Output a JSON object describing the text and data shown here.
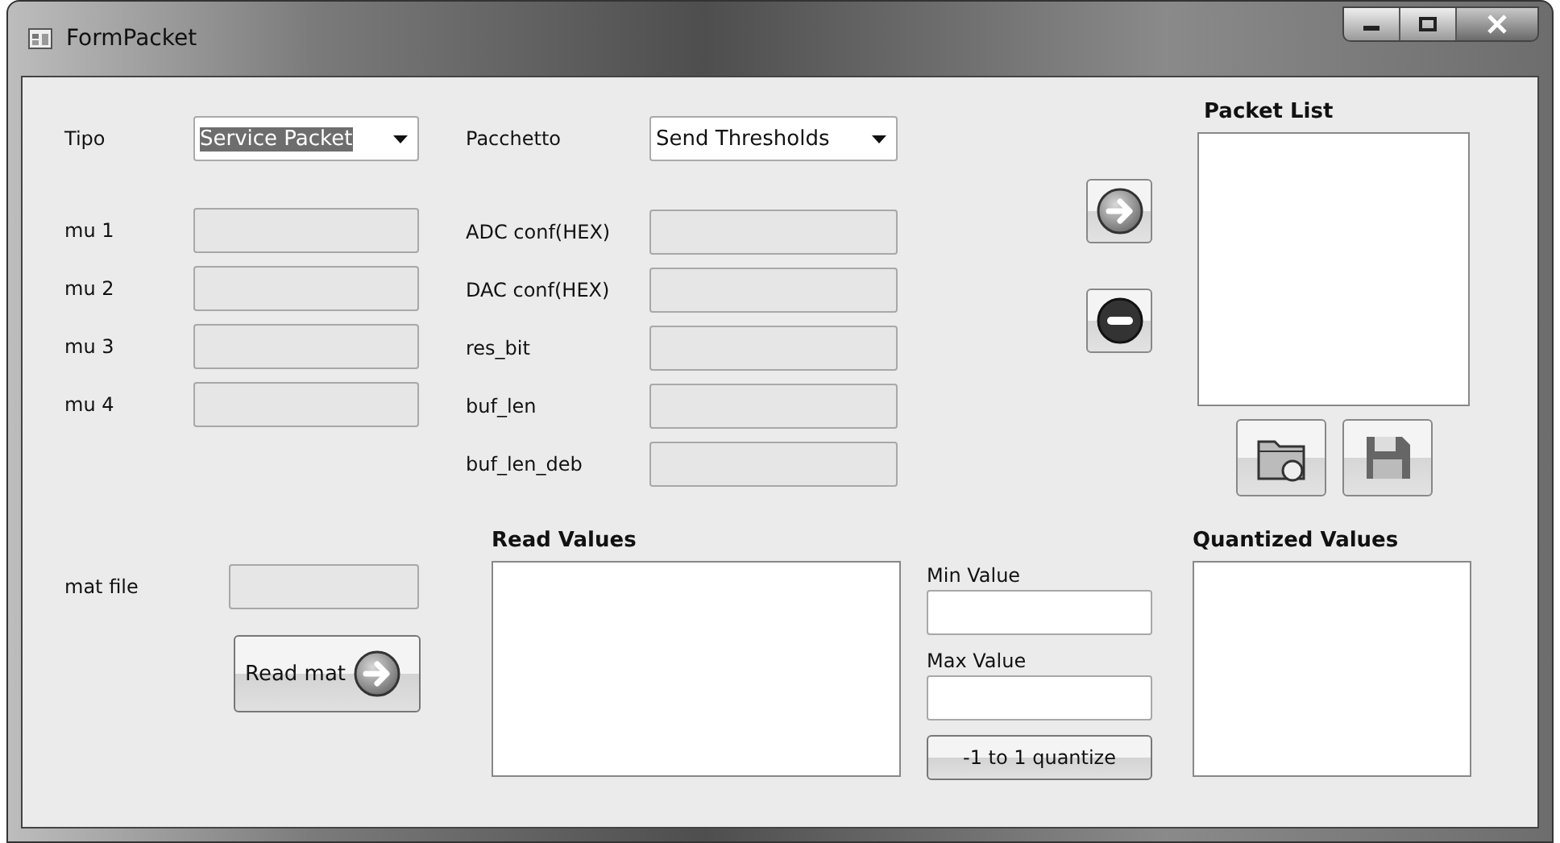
{
  "window": {
    "title": "FormPacket"
  },
  "tipo": {
    "label": "Tipo",
    "value": "Service Packet",
    "selected": true
  },
  "pacchetto": {
    "label": "Pacchetto",
    "value": "Send Thresholds",
    "selected": false
  },
  "mu_fields": [
    {
      "label": "mu 1",
      "disabled": true
    },
    {
      "label": "mu 2",
      "disabled": true
    },
    {
      "label": "mu 3",
      "disabled": true
    },
    {
      "label": "mu 4",
      "disabled": true
    }
  ],
  "config_fields": [
    {
      "label": "ADC conf(HEX)",
      "disabled": true
    },
    {
      "label": "DAC conf(HEX)",
      "disabled": true
    },
    {
      "label": "res_bit",
      "disabled": true
    },
    {
      "label": "buf_len",
      "disabled": true
    },
    {
      "label": "buf_len_deb",
      "disabled": true
    }
  ],
  "packet_list": {
    "title": "Packet List"
  },
  "mat_file": {
    "label": "mat file",
    "disabled": true
  },
  "read_mat_button": "Read mat",
  "read_values": {
    "title": "Read Values"
  },
  "min_value": {
    "label": "Min Value",
    "disabled": false
  },
  "max_value": {
    "label": "Max Value",
    "disabled": false
  },
  "quantize_button": "-1 to 1 quantize",
  "quantized_values": {
    "title": "Quantized Values"
  }
}
